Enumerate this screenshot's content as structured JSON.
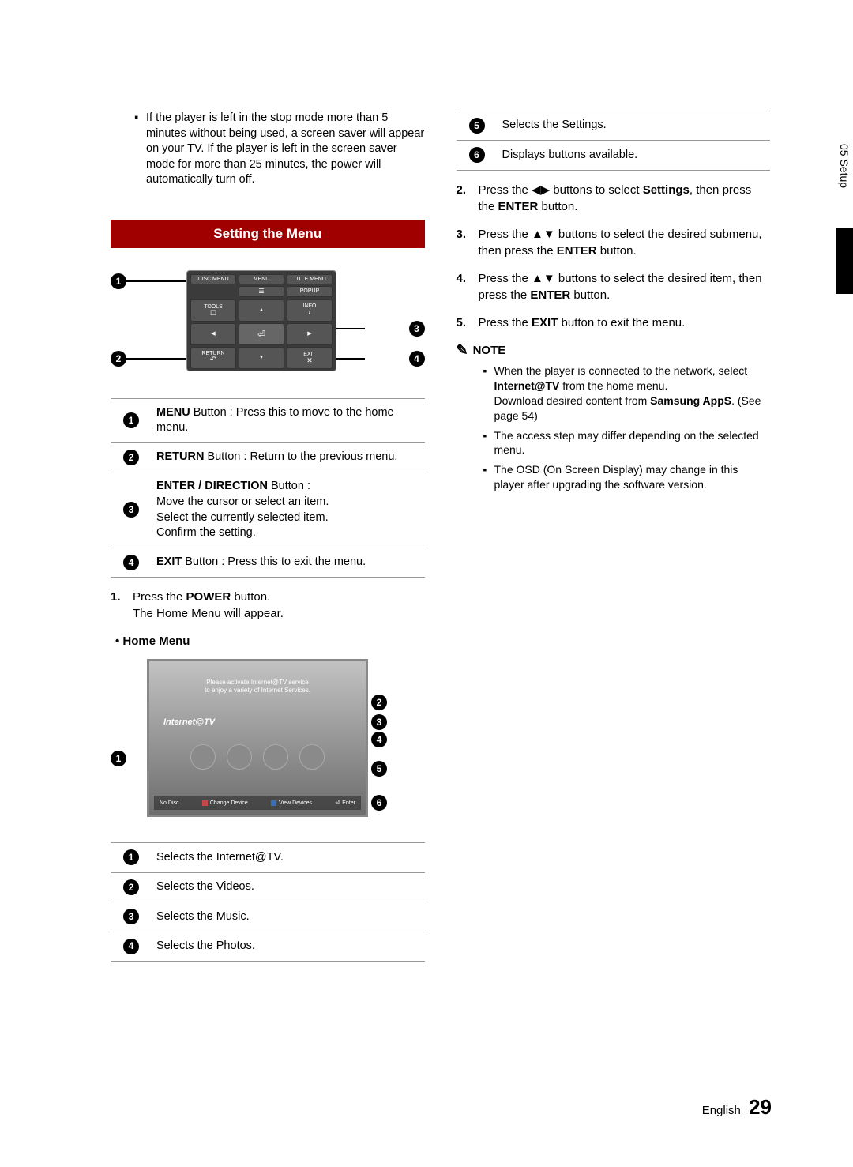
{
  "chapter_tab": "05  Setup",
  "footer": {
    "lang": "English",
    "page": "29"
  },
  "left": {
    "top_note": "If the player is left in the stop mode more than 5 minutes without being used, a screen saver will appear on your TV. If the player is left in the screen saver mode for more than 25 minutes, the power will automatically turn off.",
    "section_title": "Setting the Menu",
    "remote_labels": {
      "disc_menu": "DISC MENU",
      "menu": "MENU",
      "title_menu": "TITLE MENU",
      "popup": "POPUP",
      "tools": "TOOLS",
      "info": "INFO",
      "return": "RETURN",
      "exit": "EXIT"
    },
    "remote_table": [
      {
        "n": "1",
        "bold": "MENU",
        "text": " Button : Press this to move to the home menu."
      },
      {
        "n": "2",
        "bold": "RETURN",
        "text": " Button : Return to the previous menu."
      },
      {
        "n": "3",
        "bold": "ENTER / DIRECTION",
        "text": " Button :\nMove the cursor or select an item.\nSelect the currently selected item.\nConfirm the setting."
      },
      {
        "n": "4",
        "bold": "EXIT",
        "text": " Button : Press this to exit the menu."
      }
    ],
    "step1": {
      "n": "1.",
      "pre": "Press the ",
      "bold": "POWER",
      "post": " button.\nThe Home Menu will appear."
    },
    "home_menu_label": "• Home Menu",
    "tv": {
      "banner_line1": "Please activate Internet@TV service",
      "banner_line2": "to enjoy a variety of Internet Services.",
      "brand": "Internet@TV",
      "bar_left": "No Disc",
      "bar_a": "Change Device",
      "bar_d": "View Devices",
      "bar_enter": "Enter"
    },
    "home_table": [
      {
        "n": "1",
        "text": "Selects the Internet@TV."
      },
      {
        "n": "2",
        "text": "Selects the Videos."
      },
      {
        "n": "3",
        "text": "Selects the Music."
      },
      {
        "n": "4",
        "text": "Selects the Photos."
      }
    ]
  },
  "right": {
    "top_table": [
      {
        "n": "5",
        "text": "Selects the Settings."
      },
      {
        "n": "6",
        "text": "Displays buttons available."
      }
    ],
    "steps": [
      {
        "n": "2.",
        "parts": [
          "Press the ",
          "◀▶",
          " buttons to select ",
          "Settings",
          ", then press the ",
          "ENTER",
          " button."
        ]
      },
      {
        "n": "3.",
        "parts": [
          "Press the ",
          "▲▼",
          " buttons to select the desired submenu, then press the ",
          "ENTER",
          " button."
        ]
      },
      {
        "n": "4.",
        "parts": [
          "Press the ",
          "▲▼",
          " buttons to select the desired item, then press the ",
          "ENTER",
          " button."
        ]
      },
      {
        "n": "5.",
        "parts": [
          "Press the ",
          "EXIT",
          " button to exit the menu."
        ]
      }
    ],
    "note_label": "NOTE",
    "notes": [
      {
        "parts": [
          "When the player is connected to the network, select ",
          "Internet@TV",
          " from the home menu.\nDownload desired content from ",
          "Samsung AppS",
          ". (See page 54)"
        ]
      },
      {
        "parts": [
          "The access step may differ depending on the selected menu."
        ]
      },
      {
        "parts": [
          "The OSD (On Screen Display) may change in this player after upgrading the software version."
        ]
      }
    ]
  }
}
